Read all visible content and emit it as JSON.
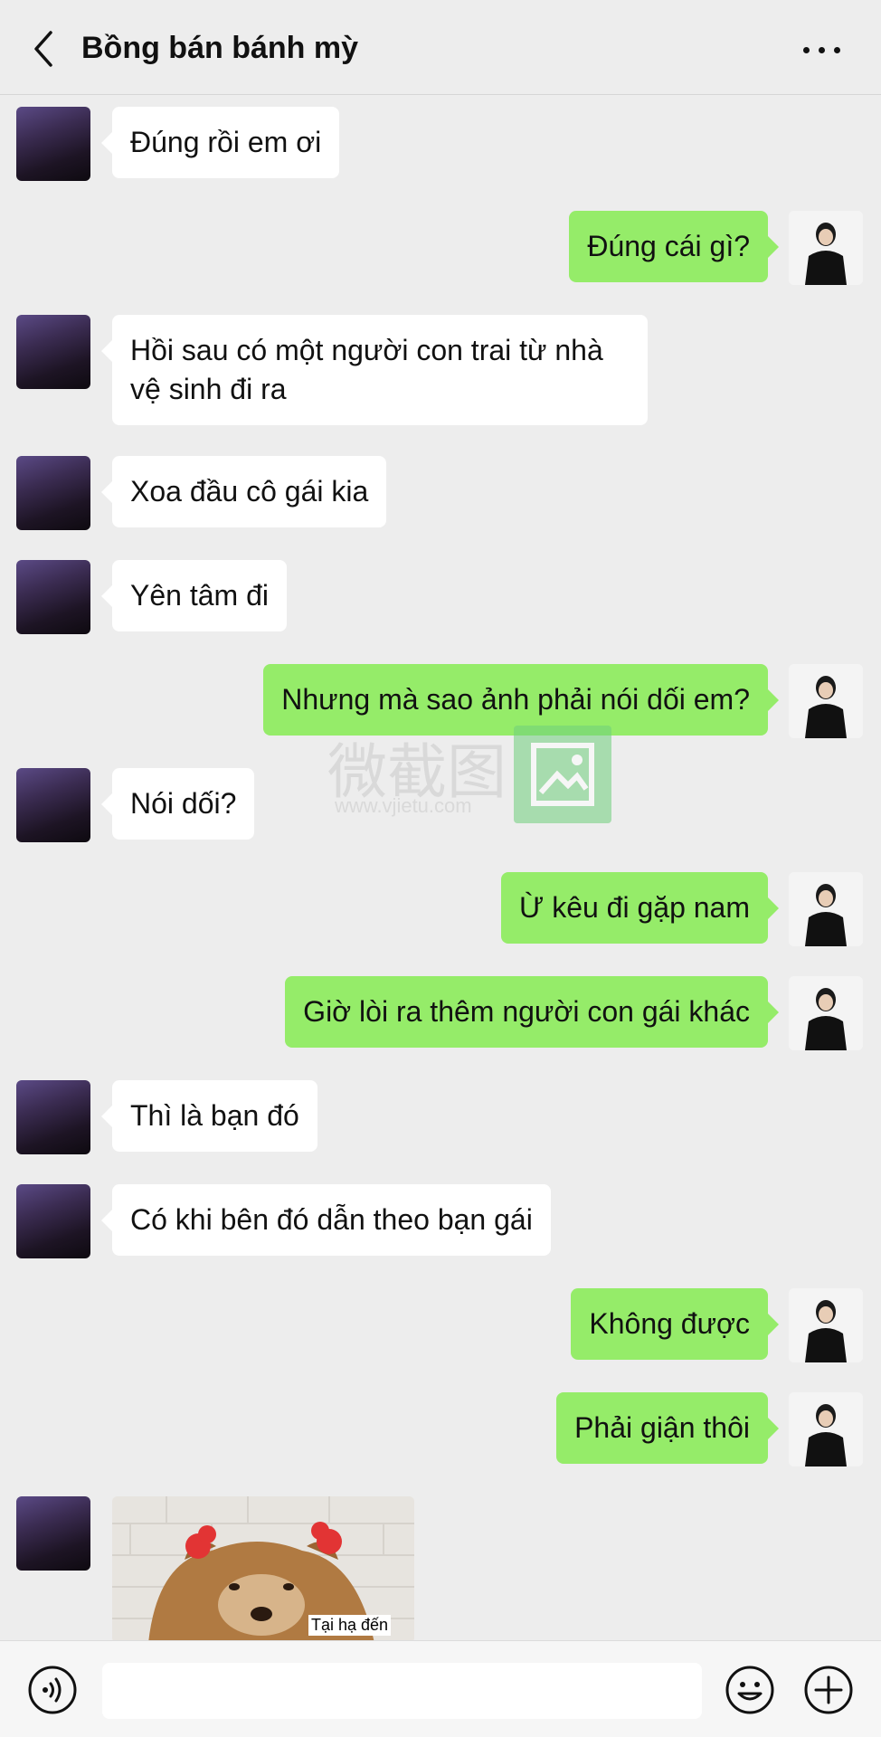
{
  "header": {
    "title": "Bồng bán bánh mỳ"
  },
  "messages": [
    {
      "side": "left",
      "text": "Đúng rồi em ơi"
    },
    {
      "side": "right",
      "text": "Đúng cái gì?"
    },
    {
      "side": "left",
      "text": "Hồi sau có một người con trai từ nhà vệ sinh đi ra"
    },
    {
      "side": "left",
      "text": "Xoa đầu cô gái kia"
    },
    {
      "side": "left",
      "text": "Yên tâm đi"
    },
    {
      "side": "right",
      "text": "Nhưng mà sao ảnh phải nói dối em?"
    },
    {
      "side": "left",
      "text": "Nói dối?"
    },
    {
      "side": "right",
      "text": "Ừ kêu đi gặp nam"
    },
    {
      "side": "right",
      "text": "Giờ lòi ra thêm người con gái khác"
    },
    {
      "side": "left",
      "text": "Thì là bạn đó"
    },
    {
      "side": "left",
      "text": "Có khi bên đó dẫn theo bạn gái"
    },
    {
      "side": "right",
      "text": "Không được"
    },
    {
      "side": "right",
      "text": "Phải giận thôi"
    },
    {
      "side": "left",
      "sticker_caption": "Tại hạ đến"
    }
  ],
  "watermark": {
    "text": "微截图",
    "url": "www.vjietu.com"
  },
  "input": {
    "value": ""
  },
  "colors": {
    "background": "#ededed",
    "self_bubble": "#95ec69",
    "other_bubble": "#ffffff"
  },
  "icons": {
    "back": "chevron-left-icon",
    "more": "more-dots-icon",
    "voice": "voice-icon",
    "emoji": "emoji-icon",
    "plus": "plus-icon"
  }
}
